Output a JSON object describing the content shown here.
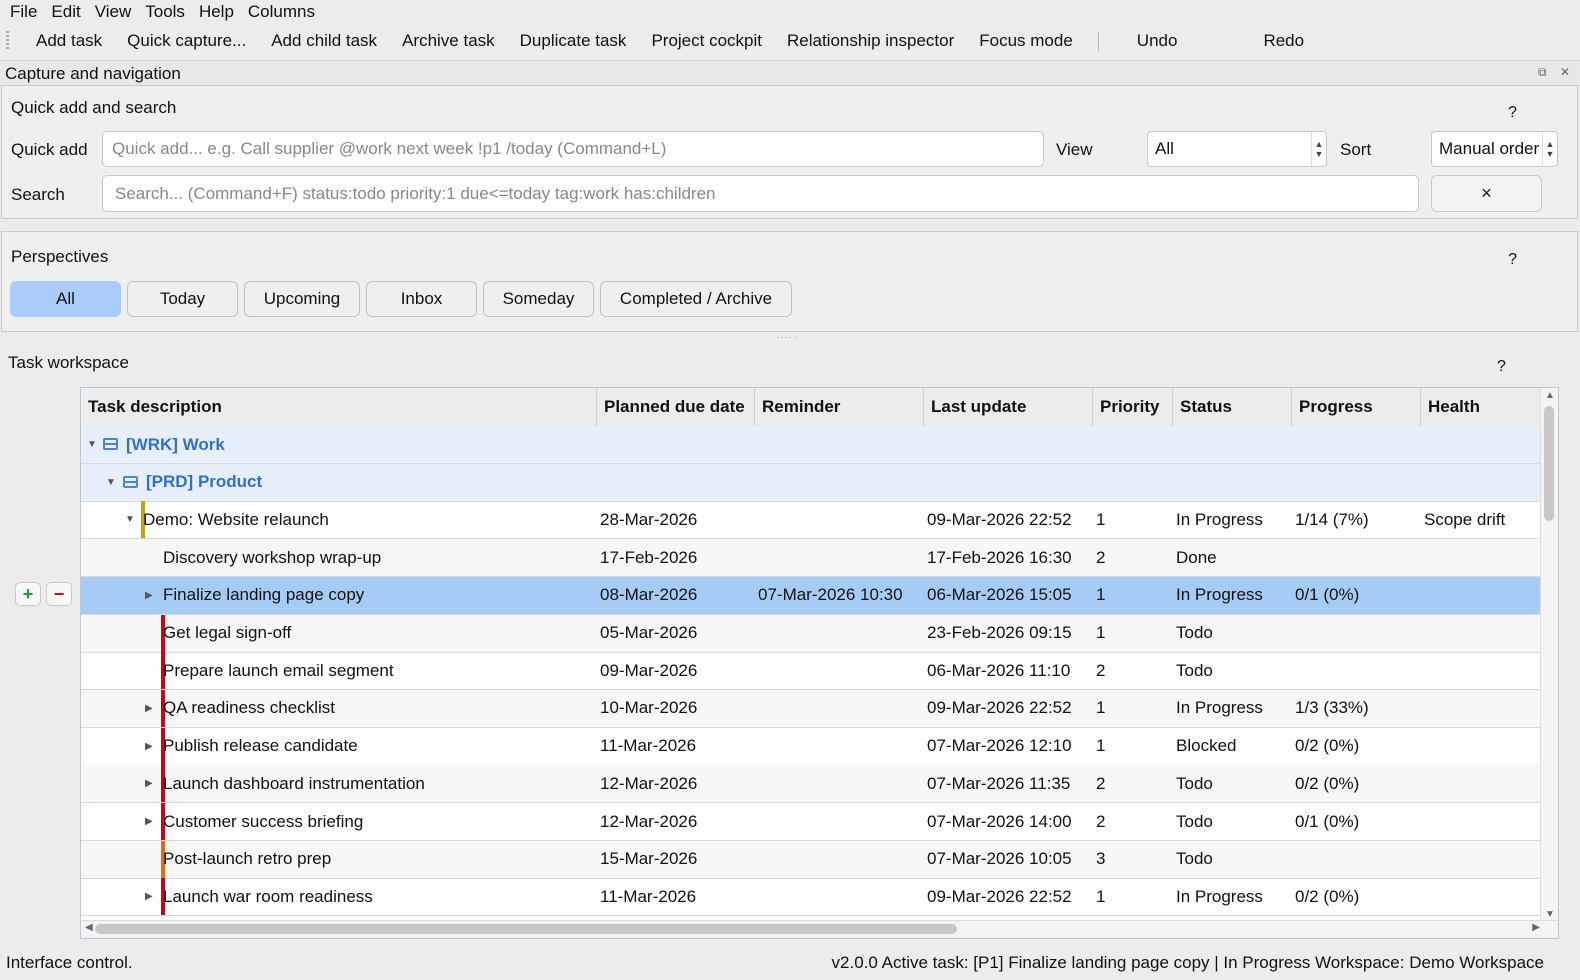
{
  "menu": [
    "File",
    "Edit",
    "View",
    "Tools",
    "Help",
    "Columns"
  ],
  "toolbar": {
    "actions": [
      "Add task",
      "Quick capture...",
      "Add child task",
      "Archive task",
      "Duplicate task",
      "Project cockpit",
      "Relationship inspector",
      "Focus mode"
    ],
    "undo": "Undo",
    "redo": "Redo"
  },
  "dock": {
    "title": "Capture and navigation"
  },
  "quick": {
    "title": "Quick add and search",
    "help": "?",
    "quick_label": "Quick add",
    "quick_placeholder": "Quick add... e.g. Call supplier @work next week !p1 /today (Command+L)",
    "view_label": "View",
    "view_value": "All",
    "sort_label": "Sort",
    "sort_value": "Manual order",
    "search_label": "Search",
    "search_placeholder": "Search... (Command+F)  status:todo priority:1 due<=today tag:work has:children",
    "clear": "×"
  },
  "perspectives": {
    "title": "Perspectives",
    "help": "?",
    "items": [
      "All",
      "Today",
      "Upcoming",
      "Inbox",
      "Someday",
      "Completed / Archive"
    ],
    "active": "All"
  },
  "workspace": {
    "title": "Task workspace",
    "help": "?",
    "add": "+",
    "remove": "−",
    "columns": [
      "Task description",
      "Planned due date",
      "Reminder",
      "Last update",
      "Priority",
      "Status",
      "Progress",
      "Health"
    ],
    "groups": [
      "[WRK] Work",
      "[PRD] Product"
    ],
    "colors": {
      "selected": "#a6ccf6",
      "group_text": "#2d6fd6",
      "project_bar": "#c9a400",
      "task_bar": "#d0021b",
      "low_bar": "#e86a10"
    },
    "rows": [
      {
        "desc": "Demo: Website relaunch",
        "due": "28-Mar-2026",
        "reminder": "",
        "updated": "09-Mar-2026 22:52",
        "priority": "1",
        "status": "In Progress",
        "progress": "1/14 (7%)",
        "health": "Scope drift"
      },
      {
        "desc": "Discovery workshop wrap-up",
        "due": "17-Feb-2026",
        "reminder": "",
        "updated": "17-Feb-2026 16:30",
        "priority": "2",
        "status": "Done",
        "progress": "",
        "health": ""
      },
      {
        "desc": "Finalize landing page copy",
        "due": "08-Mar-2026",
        "reminder": "07-Mar-2026 10:30",
        "updated": "06-Mar-2026 15:05",
        "priority": "1",
        "status": "In Progress",
        "progress": "0/1 (0%)",
        "health": ""
      },
      {
        "desc": "Get legal sign-off",
        "due": "05-Mar-2026",
        "reminder": "",
        "updated": "23-Feb-2026 09:15",
        "priority": "1",
        "status": "Todo",
        "progress": "",
        "health": ""
      },
      {
        "desc": "Prepare launch email segment",
        "due": "09-Mar-2026",
        "reminder": "",
        "updated": "06-Mar-2026 11:10",
        "priority": "2",
        "status": "Todo",
        "progress": "",
        "health": ""
      },
      {
        "desc": "QA readiness checklist",
        "due": "10-Mar-2026",
        "reminder": "",
        "updated": "09-Mar-2026 22:52",
        "priority": "1",
        "status": "In Progress",
        "progress": "1/3 (33%)",
        "health": ""
      },
      {
        "desc": "Publish release candidate",
        "due": "11-Mar-2026",
        "reminder": "",
        "updated": "07-Mar-2026 12:10",
        "priority": "1",
        "status": "Blocked",
        "progress": "0/2 (0%)",
        "health": ""
      },
      {
        "desc": "Launch dashboard instrumentation",
        "due": "12-Mar-2026",
        "reminder": "",
        "updated": "07-Mar-2026 11:35",
        "priority": "2",
        "status": "Todo",
        "progress": "0/2 (0%)",
        "health": ""
      },
      {
        "desc": "Customer success briefing",
        "due": "12-Mar-2026",
        "reminder": "",
        "updated": "07-Mar-2026 14:00",
        "priority": "2",
        "status": "Todo",
        "progress": "0/1 (0%)",
        "health": ""
      },
      {
        "desc": "Post-launch retro prep",
        "due": "15-Mar-2026",
        "reminder": "",
        "updated": "07-Mar-2026 10:05",
        "priority": "3",
        "status": "Todo",
        "progress": "",
        "health": ""
      },
      {
        "desc": "Launch war room readiness",
        "due": "11-Mar-2026",
        "reminder": "",
        "updated": "09-Mar-2026 22:52",
        "priority": "1",
        "status": "In Progress",
        "progress": "0/2 (0%)",
        "health": ""
      }
    ]
  },
  "status": {
    "left": "Interface control.",
    "right": "v2.0.0  Active task: [P1] Finalize landing page copy | In Progress  Workspace: Demo Workspace"
  }
}
